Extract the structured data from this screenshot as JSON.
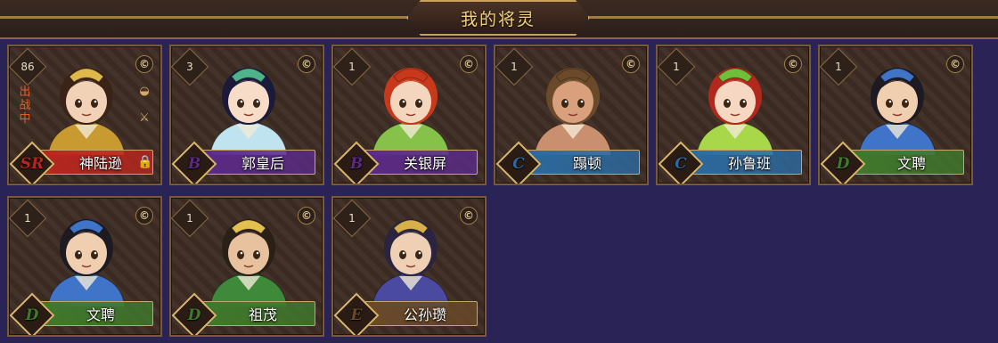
{
  "header": {
    "title": "我的将灵"
  },
  "colors": {
    "SR": "#b8261f",
    "B": "#5b2a86",
    "C": "#2c6aa0",
    "D": "#3f7a2c",
    "E": "#6a4a2a"
  },
  "cards": [
    {
      "level": "86",
      "grade": "SR",
      "name": "神陆逊",
      "status": "出战中",
      "locked": true,
      "side_icons": [
        "coin",
        "bowl",
        "sword"
      ],
      "hair": "#3a2418",
      "outfit": "#c89a30",
      "skin": "#f2d2b6",
      "crown": "#e0b84a"
    },
    {
      "level": "3",
      "grade": "B",
      "name": "郭皇后",
      "status": "",
      "locked": false,
      "side_icons": [
        "coin"
      ],
      "hair": "#1c1a3a",
      "outfit": "#bfe4f0",
      "skin": "#f7dcc8",
      "crown": "#4fb38a"
    },
    {
      "level": "1",
      "grade": "B",
      "name": "关银屏",
      "status": "",
      "locked": false,
      "side_icons": [
        "coin"
      ],
      "hair": "#c8391c",
      "outfit": "#86c24a",
      "skin": "#f4d6bf",
      "crown": "#c8391c"
    },
    {
      "level": "1",
      "grade": "C",
      "name": "蹋顿",
      "status": "",
      "locked": false,
      "side_icons": [
        "coin"
      ],
      "hair": "#6b4a2a",
      "outfit": "#c98f6e",
      "skin": "#d9a07e",
      "crown": "#6b4a2a"
    },
    {
      "level": "1",
      "grade": "C",
      "name": "孙鲁班",
      "status": "",
      "locked": false,
      "side_icons": [
        "coin"
      ],
      "hair": "#b2281c",
      "outfit": "#a8d84a",
      "skin": "#f6d8c2",
      "crown": "#6fbf3a"
    },
    {
      "level": "1",
      "grade": "D",
      "name": "文聘",
      "status": "",
      "locked": false,
      "side_icons": [
        "coin"
      ],
      "hair": "#1d1a22",
      "outfit": "#3f74c8",
      "skin": "#f0cfb0",
      "crown": "#3f74c8"
    },
    {
      "level": "1",
      "grade": "D",
      "name": "文聘",
      "status": "",
      "locked": false,
      "side_icons": [
        "coin"
      ],
      "hair": "#1d1a22",
      "outfit": "#3f74c8",
      "skin": "#f0cfb0",
      "crown": "#3f74c8"
    },
    {
      "level": "1",
      "grade": "D",
      "name": "祖茂",
      "status": "",
      "locked": false,
      "side_icons": [
        "coin"
      ],
      "hair": "#2a2018",
      "outfit": "#3f8a3a",
      "skin": "#e8c29e",
      "crown": "#e2c050"
    },
    {
      "level": "1",
      "grade": "E",
      "name": "公孙瓒",
      "status": "",
      "locked": false,
      "side_icons": [
        "coin"
      ],
      "hair": "#2a2440",
      "outfit": "#4a4aa0",
      "skin": "#f0d0b4",
      "crown": "#d8b04a"
    }
  ]
}
